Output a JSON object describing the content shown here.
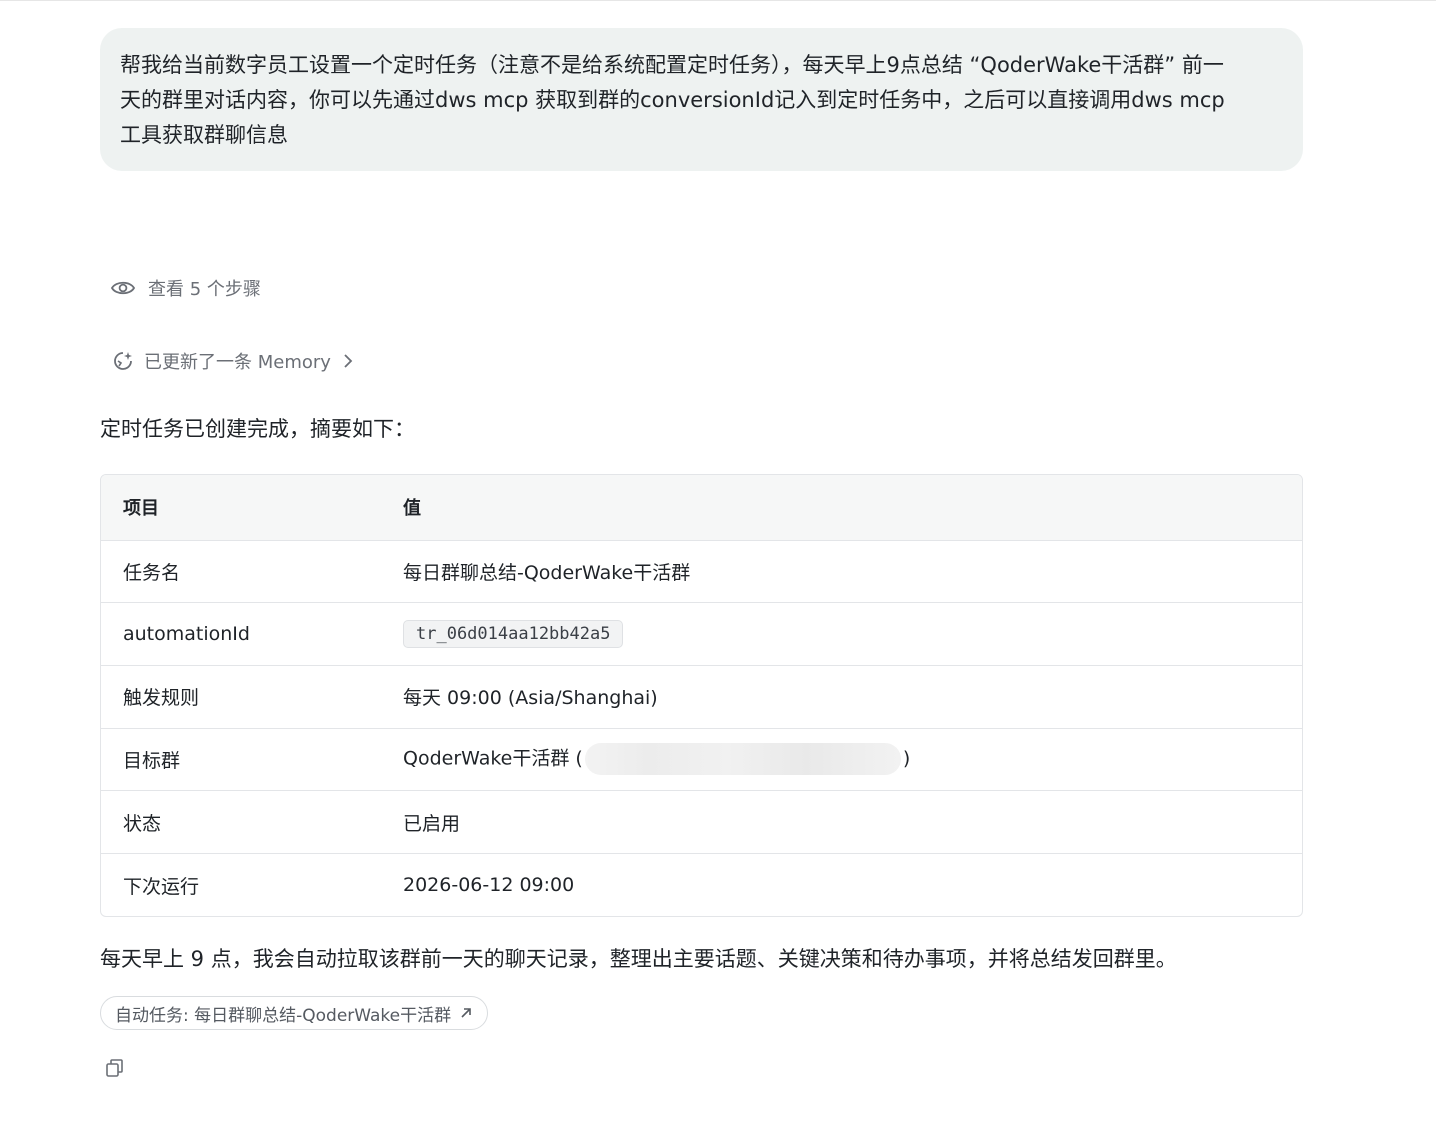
{
  "user_message": {
    "line1": "帮我给当前数字员工设置一个定时任务（注意不是给系统配置定时任务），每天早上9点总结 “QoderWake干活群” 前一",
    "line2": "天的群里对话内容，你可以先通过dws mcp 获取到群的conversionId记入到定时任务中，之后可以直接调用dws mcp",
    "line3": "工具获取群聊信息"
  },
  "steps": {
    "label": "查看 5 个步骤",
    "icon": "eye-icon"
  },
  "memory": {
    "label": "已更新了一条 Memory",
    "icon": "memory-sparkle-icon",
    "chevron_icon": "chevron-right-icon"
  },
  "intro": "定时任务已创建完成，摘要如下：",
  "table": {
    "headers": [
      "项目",
      "值"
    ],
    "rows": [
      {
        "key": "任务名",
        "value": "每日群聊总结-QoderWake干活群"
      },
      {
        "key": "automationId",
        "value": "tr_06d014aa12bb42a5"
      },
      {
        "key": "触发规则",
        "value": "每天 09:00 (Asia/Shanghai)"
      },
      {
        "key": "目标群",
        "value_prefix": "QoderWake干活群 (",
        "value_suffix": ")"
      },
      {
        "key": "状态",
        "value": "已启用"
      },
      {
        "key": "下次运行",
        "value": "2026-06-12 09:00"
      }
    ]
  },
  "summary": "每天早上 9 点，我会自动拉取该群前一天的聊天记录，整理出主要话题、关键决策和待办事项，并将总结发回群里。",
  "chip": {
    "label": "自动任务: 每日群聊总结-QoderWake干活群",
    "icon": "arrow-up-right-icon"
  },
  "copy": {
    "icon": "copy-icon"
  },
  "colors": {
    "bubble_bg": "#eef2f1",
    "muted_text": "#6b6f76",
    "table_header_bg": "#f6f7f7",
    "border": "#e3e5e8"
  }
}
